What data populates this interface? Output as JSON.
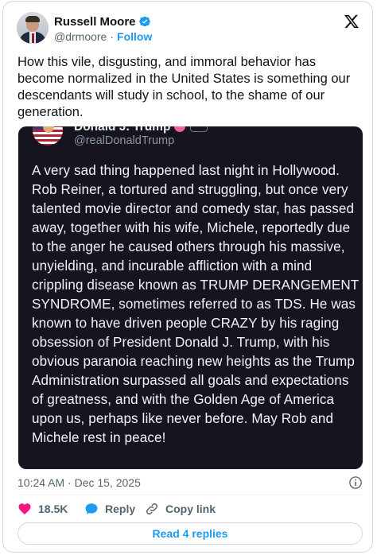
{
  "author": {
    "display_name": "Russell Moore",
    "handle": "@drmoore",
    "separator": "·",
    "follow_label": "Follow",
    "verified": true
  },
  "tweet": {
    "text": "How this vile, disgusting, and immoral behavior has become normalized in the United States is something our descendants will study in school, to the shame of our generation.",
    "timestamp": "10:24 AM · Dec 15, 2025"
  },
  "embedded_post": {
    "display_name": "Donald J. Trump",
    "handle": "@realDonaldTrump",
    "text": "A very sad thing happened last night in Hollywood. Rob Reiner, a tortured and struggling, but once very talented movie director and comedy star, has passed away, together with his wife, Michele, reportedly due to the anger he caused others through his massive, unyielding, and incurable affliction with a mind crippling disease known as TRUMP DERANGEMENT SYNDROME, sometimes referred to as TDS. He was known to have driven people CRAZY by his raging obsession of President Donald J. Trump, with his obvious paranoia reaching new heights as the Trump Administration surpassed all goals and expectations of greatness, and with the Golden Age of America upon us, perhaps like never before. May Rob and Michele rest in peace!"
  },
  "actions": {
    "like_count": "18.5K",
    "reply_label": "Reply",
    "copy_link_label": "Copy link"
  },
  "replies_button": "Read 4 replies",
  "colors": {
    "accent": "#1d9bf0",
    "like": "#f91880",
    "embed_background": "#15141f",
    "secondary_text": "#536471"
  },
  "icons": [
    "x-logo-icon",
    "verified-badge-icon",
    "info-icon",
    "heart-icon",
    "reply-bubble-icon",
    "link-icon"
  ]
}
